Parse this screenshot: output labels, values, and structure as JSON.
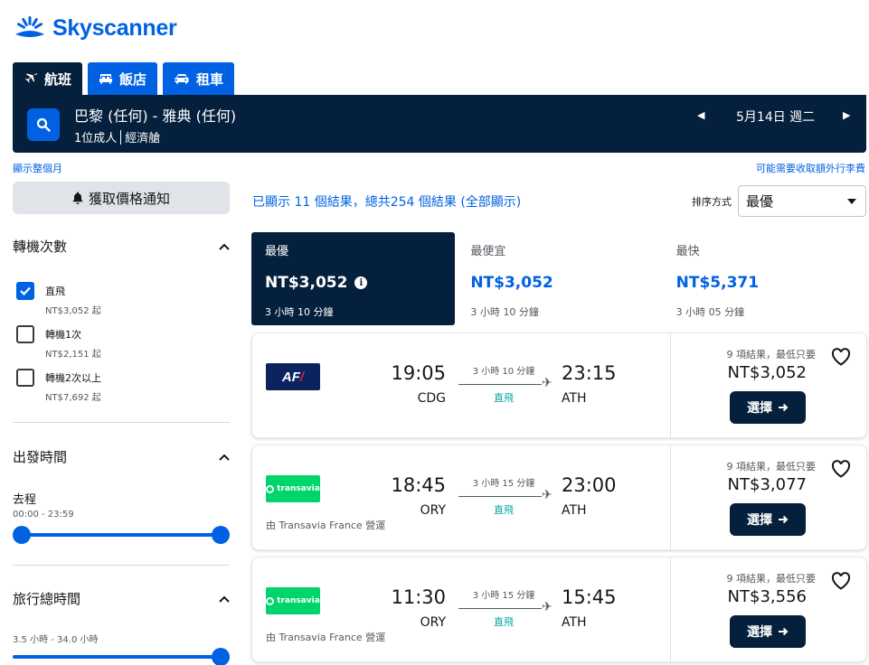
{
  "brand": {
    "name": "Skyscanner"
  },
  "tabs": [
    {
      "label": "航班",
      "icon": "plane-icon",
      "active": true
    },
    {
      "label": "飯店",
      "icon": "bed-icon",
      "active": false
    },
    {
      "label": "租車",
      "icon": "car-icon",
      "active": false
    }
  ],
  "search": {
    "route": "巴黎 (任何) - 雅典 (任何)",
    "passengers": "1位成人",
    "cabin": "經濟艙",
    "date": "5月14日 週二"
  },
  "links": {
    "whole_month": "顯示整個月",
    "baggage_fees": "可能需要收取額外行李費"
  },
  "price_alert": {
    "label": "獲取價格通知"
  },
  "filters": {
    "stops": {
      "title": "轉機次數",
      "options": [
        {
          "label": "直飛",
          "price": "NT$3,052 起",
          "checked": true
        },
        {
          "label": "轉機1次",
          "price": "NT$2,151 起",
          "checked": false
        },
        {
          "label": "轉機2次以上",
          "price": "NT$7,692 起",
          "checked": false
        }
      ]
    },
    "departure_time": {
      "title": "出發時間",
      "leg_label": "去程",
      "range": "00:00 - 23:59"
    },
    "duration": {
      "title": "旅行總時間",
      "range": "3.5 小時 - 34.0 小時"
    }
  },
  "results": {
    "summary": "已顯示 11 個結果，總共254 個結果 (全部顯示)",
    "sort_label": "排序方式",
    "sort_value": "最優"
  },
  "sort_tabs": [
    {
      "name": "最優",
      "price": "NT$3,052",
      "duration": "3 小時 10 分鐘",
      "active": true
    },
    {
      "name": "最便宜",
      "price": "NT$3,052",
      "duration": "3 小時 10 分鐘",
      "active": false
    },
    {
      "name": "最快",
      "price": "NT$5,371",
      "duration": "3 小時 05 分鐘",
      "active": false
    }
  ],
  "flights": [
    {
      "airline_logo_text": "AF",
      "dep_time": "19:05",
      "dep_code": "CDG",
      "duration": "3 小時 10 分鐘",
      "stops": "直飛",
      "arr_time": "23:15",
      "arr_code": "ATH",
      "operated_by": "",
      "deals": "9 項結果，最低只要",
      "price": "NT$3,052",
      "select_label": "選擇"
    },
    {
      "airline_logo_text": "transavia",
      "dep_time": "18:45",
      "dep_code": "ORY",
      "duration": "3 小時 15 分鐘",
      "stops": "直飛",
      "arr_time": "23:00",
      "arr_code": "ATH",
      "operated_by": "由 Transavia France 營運",
      "deals": "9 項結果，最低只要",
      "price": "NT$3,077",
      "select_label": "選擇"
    },
    {
      "airline_logo_text": "transavia",
      "dep_time": "11:30",
      "dep_code": "ORY",
      "duration": "3 小時 15 分鐘",
      "stops": "直飛",
      "arr_time": "15:45",
      "arr_code": "ATH",
      "operated_by": "由 Transavia France 營運",
      "deals": "9 項結果，最低只要",
      "price": "NT$3,556",
      "select_label": "選擇"
    }
  ],
  "colors": {
    "brand_blue": "#0062e3",
    "navy": "#05203c",
    "direct_green": "#00a698",
    "transavia_green": "#00d56a",
    "af_navy": "#0b2460"
  }
}
